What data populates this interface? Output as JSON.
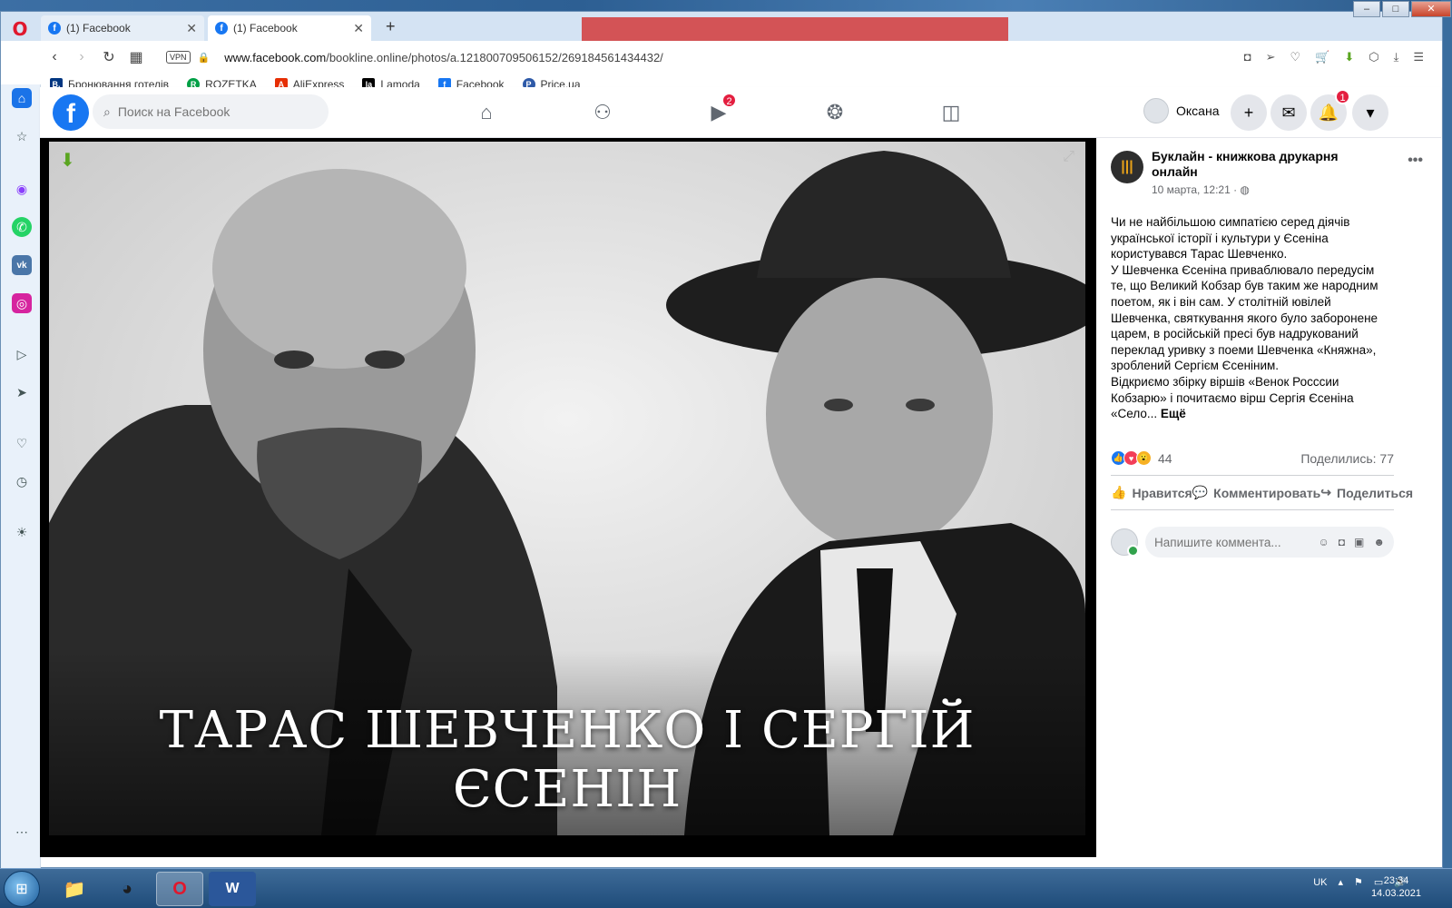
{
  "browser": {
    "tabs": [
      {
        "title": "(1) Facebook"
      },
      {
        "title": "(1) Facebook"
      }
    ],
    "address": {
      "vpn": "VPN",
      "url_domain": "www.facebook.com",
      "url_path": "/bookline.online/photos/a.121800709506152/269184561434432/"
    },
    "bookmarks": [
      {
        "label": "Бронювання готелів",
        "icon": "B.",
        "color": "#003580"
      },
      {
        "label": "ROZETKA",
        "icon": "R",
        "color": "#00a046"
      },
      {
        "label": "AliExpress",
        "icon": "A",
        "color": "#e62e04"
      },
      {
        "label": "Lamoda",
        "icon": "la",
        "color": "#000000"
      },
      {
        "label": "Facebook",
        "icon": "f",
        "color": "#1877f2"
      },
      {
        "label": "Price.ua",
        "icon": "P",
        "color": "#2e5aa8"
      }
    ]
  },
  "facebook": {
    "search_placeholder": "Поиск на Facebook",
    "watch_badge": "2",
    "user_name": "Оксана",
    "notif_badge": "1"
  },
  "photo": {
    "caption": "ТАРАС ШЕВЧЕНКО І СЕРГІЙ ЄСЕНІН"
  },
  "post": {
    "page_name": "Буклайн - книжкова друкарня онлайн",
    "date": "10 марта, 12:21 · ",
    "text_lines": [
      "Чи не найбільшою симпатією серед діячів української історії і культури у Єсеніна користувався Тарас Шевченко.",
      "У Шевченка Єсеніна приваблювало передусім те, що Великий Кобзар був таким же народним поетом, як і він сам. У столітній ювілей Шевченка, святкування якого було заборонене царем, в російській пресі був надрукований переклад уривку з поеми Шевченка «Княжна», зроблений Сергієм Єсеніним.",
      "Відкриємо збірку віршів «Венок Росссии Кобзарю» і почитаємо вірш Сергія Єсеніна «Село..."
    ],
    "more_link": "Ещё",
    "reaction_count": "44",
    "shares": "Поделились: 77",
    "actions": {
      "like": "Нравится",
      "comment": "Комментировать",
      "share": "Поделиться"
    },
    "comment_placeholder": "Напишите коммента..."
  },
  "taskbar": {
    "lang": "UK",
    "time": "23:34",
    "date": "14.03.2021"
  },
  "colors": {
    "fb_blue": "#1877f2",
    "badge_red": "#e41e3f",
    "opera_red": "#e0182d"
  }
}
